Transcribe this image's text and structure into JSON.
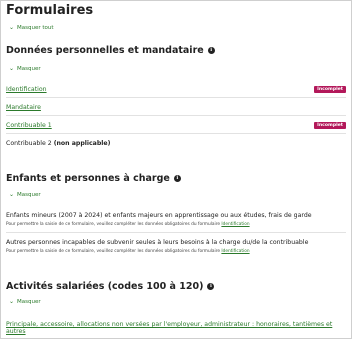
{
  "page_title": "Formulaires",
  "hide_all": "Masquer tout",
  "sections": [
    {
      "title": "Données personnelles et mandataire",
      "toggle": "Masquer",
      "rows": [
        {
          "label": "Identification",
          "badge": "Incomplet"
        },
        {
          "label": "Mandataire",
          "badge": ""
        },
        {
          "label": "Contribuable 1",
          "badge": "Incomplet"
        },
        {
          "label": "Contribuable 2",
          "note": "(non applicable)"
        }
      ]
    },
    {
      "title": "Enfants et personnes à charge",
      "toggle": "Masquer",
      "rows": [
        {
          "label": "Enfants mineurs (2007 à 2024) et enfants majeurs en apprentissage ou aux études, frais de garde",
          "sub_text": "Pour permettre la saisie de ce formulaire, veuillez compléter les données obligatoires du formulaire",
          "sub_link": "Identification"
        },
        {
          "label": "Autres personnes incapables de subvenir seules à leurs besoins à la charge du/de la contribuable",
          "sub_text": "Pour permettre la saisie de ce formulaire, veuillez compléter les données obligatoires du formulaire",
          "sub_link": "Identification"
        }
      ]
    },
    {
      "title": "Activités salariées (codes 100 à 120)",
      "toggle": "Masquer",
      "rows": [
        {
          "label": "Principale, accessoire, allocations non versées par l'employeur, administrateur : honoraires, tantièmes et autres"
        }
      ]
    }
  ],
  "icons": {
    "info": "info-icon",
    "chevron": "chevron-down-icon"
  },
  "colors": {
    "link": "#2b7a2b",
    "badge": "#b3185a"
  }
}
